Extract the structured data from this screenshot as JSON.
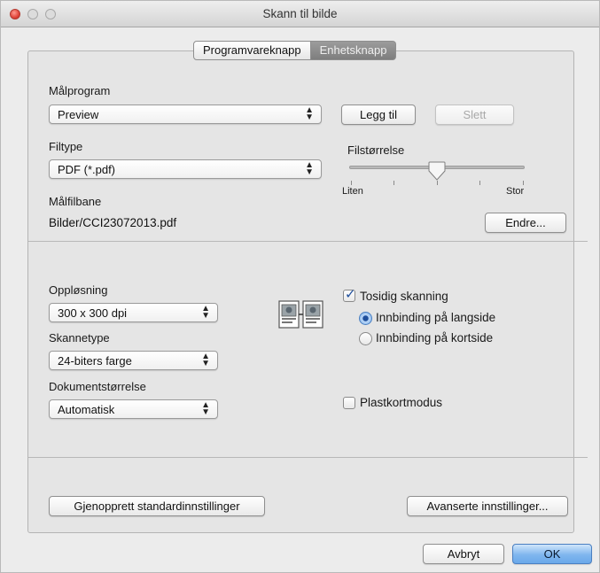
{
  "window": {
    "title": "Skann til bilde"
  },
  "tabs": {
    "software": "Programvareknapp",
    "device": "Enhetsknapp"
  },
  "target": {
    "label": "Målprogram",
    "selected": "Preview",
    "add_button": "Legg til",
    "delete_button": "Slett"
  },
  "filetype": {
    "label": "Filtype",
    "selected": "PDF (*.pdf)"
  },
  "filesize": {
    "label": "Filstørrelse",
    "min_label": "Liten",
    "max_label": "Stor"
  },
  "path": {
    "label": "Målfilbane",
    "value": "Bilder/CCI23072013.pdf",
    "change_button": "Endre..."
  },
  "resolution": {
    "label": "Oppløsning",
    "selected": "300 x 300 dpi"
  },
  "scantype": {
    "label": "Skannetype",
    "selected": "24-biters farge"
  },
  "docsize": {
    "label": "Dokumentstørrelse",
    "selected": "Automatisk"
  },
  "duplex": {
    "label": "Tosidig skanning",
    "long_edge": "Innbinding på langside",
    "short_edge": "Innbinding på kortside"
  },
  "plastic": {
    "label": "Plastkortmodus"
  },
  "buttons": {
    "restore_defaults": "Gjenopprett standardinnstillinger",
    "advanced": "Avanserte innstillinger...",
    "cancel": "Avbryt",
    "ok": "OK"
  },
  "colors": {
    "accent": "#6aa8ea",
    "check": "#1f4f9c",
    "close": "#e0443a"
  }
}
